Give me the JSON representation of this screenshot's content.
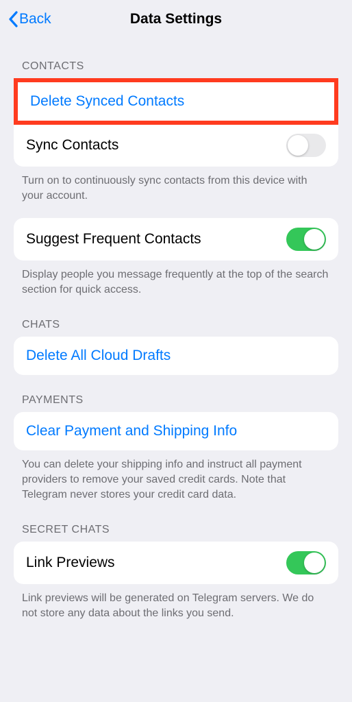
{
  "nav": {
    "back_label": "Back",
    "title": "Data Settings"
  },
  "sections": {
    "contacts": {
      "header": "CONTACTS",
      "delete_synced": "Delete Synced Contacts",
      "sync_contacts_label": "Sync Contacts",
      "sync_contacts_on": false,
      "sync_footer": "Turn on to continuously sync contacts from this device with your account.",
      "suggest_label": "Suggest Frequent Contacts",
      "suggest_on": true,
      "suggest_footer": "Display people you message frequently at the top of the search section for quick access."
    },
    "chats": {
      "header": "CHATS",
      "delete_drafts": "Delete All Cloud Drafts"
    },
    "payments": {
      "header": "PAYMENTS",
      "clear_info": "Clear Payment and Shipping Info",
      "footer": "You can delete your shipping info and instruct all payment providers to remove your saved credit cards. Note that Telegram never stores your credit card data."
    },
    "secret": {
      "header": "SECRET CHATS",
      "link_previews_label": "Link Previews",
      "link_previews_on": true,
      "footer": "Link previews will be generated on Telegram servers. We do not store any data about the links you send."
    }
  }
}
